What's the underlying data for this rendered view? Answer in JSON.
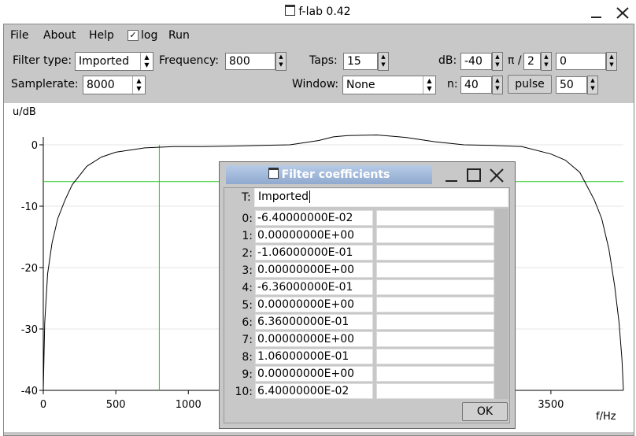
{
  "window": {
    "title": "f-lab 0.42"
  },
  "menu": {
    "file": "File",
    "about": "About",
    "help": "Help",
    "log": "log",
    "run": "Run"
  },
  "toolbar": {
    "filter_type_label": "Filter type:",
    "filter_type_value": "Imported",
    "frequency_label": "Frequency:",
    "frequency_value": "800",
    "taps_label": "Taps:",
    "taps_value": "15",
    "db_label": "dB:",
    "db_value": "-40",
    "pi_label": "π /",
    "pi_value": "2",
    "phase_value": "0",
    "samplerate_label": "Samplerate:",
    "samplerate_value": "8000",
    "window_label": "Window:",
    "window_value": "None",
    "n_label": "n:",
    "n_value": "40",
    "pulse_label": "pulse",
    "pulse_value": "50"
  },
  "chart_data": {
    "type": "line",
    "ylabel": "u/dB",
    "xlabel": "f/Hz",
    "xlim": [
      0,
      4000
    ],
    "ylim": [
      -40,
      0
    ],
    "x_ticks": [
      "0",
      "500",
      "1000",
      "3500"
    ],
    "y_ticks": [
      "0",
      "-10",
      "-20",
      "-30",
      "-40"
    ],
    "cursor_frequency": 800,
    "cursor_db": -6,
    "curve": {
      "x": [
        0,
        10,
        30,
        60,
        100,
        150,
        200,
        300,
        400,
        500,
        700,
        900,
        1100,
        1300,
        1500,
        1700,
        1900,
        2000,
        2100,
        2300,
        2500,
        2700,
        2900,
        3100,
        3300,
        3500,
        3600,
        3700,
        3800,
        3850,
        3900,
        3940,
        3970,
        3990,
        4000
      ],
      "y": [
        -40,
        -29,
        -21,
        -16,
        -12,
        -9,
        -6.5,
        -3.5,
        -2,
        -1.2,
        -0.5,
        -0.3,
        -0.3,
        -0.2,
        -0.1,
        0,
        0.7,
        1.3,
        1.5,
        1.6,
        1.2,
        0.5,
        0,
        -0.1,
        -0.3,
        -1.5,
        -2.5,
        -4.5,
        -9,
        -12,
        -17,
        -23,
        -29,
        -35,
        -40
      ]
    }
  },
  "dialog": {
    "title": "Filter coefficients",
    "t_label": "T:",
    "t_value": "Imported",
    "coefficients": [
      {
        "index": "0:",
        "value": "-6.40000000E-02"
      },
      {
        "index": "1:",
        "value": " 0.00000000E+00"
      },
      {
        "index": "2:",
        "value": "-1.06000000E-01"
      },
      {
        "index": "3:",
        "value": " 0.00000000E+00"
      },
      {
        "index": "4:",
        "value": "-6.36000000E-01"
      },
      {
        "index": "5:",
        "value": " 0.00000000E+00"
      },
      {
        "index": "6:",
        "value": " 6.36000000E-01"
      },
      {
        "index": "7:",
        "value": " 0.00000000E+00"
      },
      {
        "index": "8:",
        "value": " 1.06000000E-01"
      },
      {
        "index": "9:",
        "value": " 0.00000000E+00"
      },
      {
        "index": "10:",
        "value": " 6.40000000E-02"
      }
    ],
    "ok_label": "OK"
  }
}
